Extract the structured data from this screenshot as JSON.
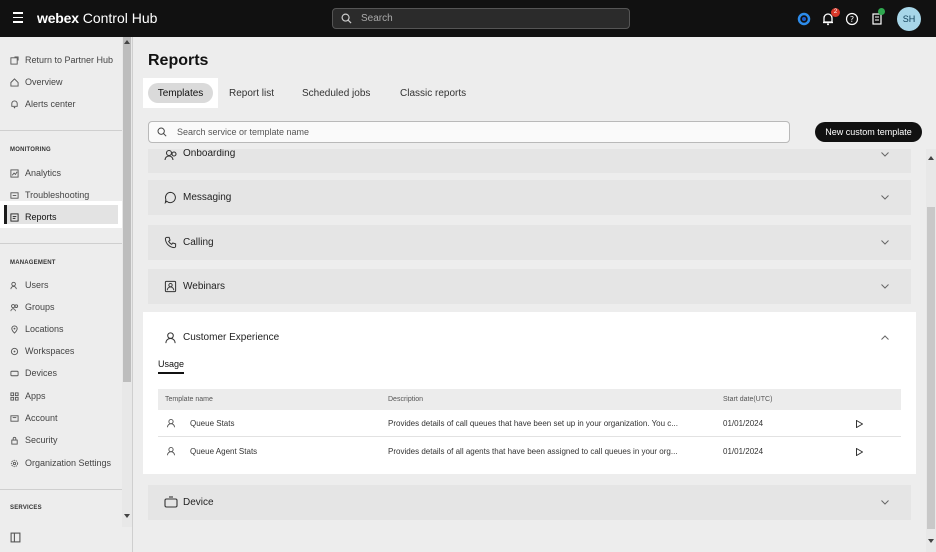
{
  "header": {
    "brand_bold": "webex",
    "brand_rest": "Control Hub",
    "search_placeholder": "Search",
    "notification_count": "2",
    "avatar_initials": "SH"
  },
  "sidebar": {
    "top_items": [
      "Return to Partner Hub",
      "Overview",
      "Alerts center"
    ],
    "monitoring_heading": "MONITORING",
    "monitoring_items": [
      "Analytics",
      "Troubleshooting",
      "Reports"
    ],
    "management_heading": "MANAGEMENT",
    "management_items": [
      "Users",
      "Groups",
      "Locations",
      "Workspaces",
      "Devices",
      "Apps",
      "Account",
      "Security",
      "Organization Settings"
    ],
    "services_heading": "SERVICES"
  },
  "main": {
    "title": "Reports",
    "tabs": [
      "Templates",
      "Report list",
      "Scheduled jobs",
      "Classic reports"
    ],
    "search_placeholder": "Search service or template name",
    "new_template_label": "New custom template",
    "sections": [
      "Onboarding",
      "Messaging",
      "Calling",
      "Webinars",
      "Customer Experience",
      "Device"
    ],
    "cx": {
      "subtab": "Usage",
      "columns": [
        "Template name",
        "Description",
        "Start date(UTC)"
      ],
      "rows": [
        {
          "name": "Queue Stats",
          "description": "Provides details of call queues that have been set up in your organization. You c...",
          "date": "01/01/2024"
        },
        {
          "name": "Queue Agent Stats",
          "description": "Provides details of all agents that have been assigned to call queues in your org...",
          "date": "01/01/2024"
        }
      ]
    }
  }
}
